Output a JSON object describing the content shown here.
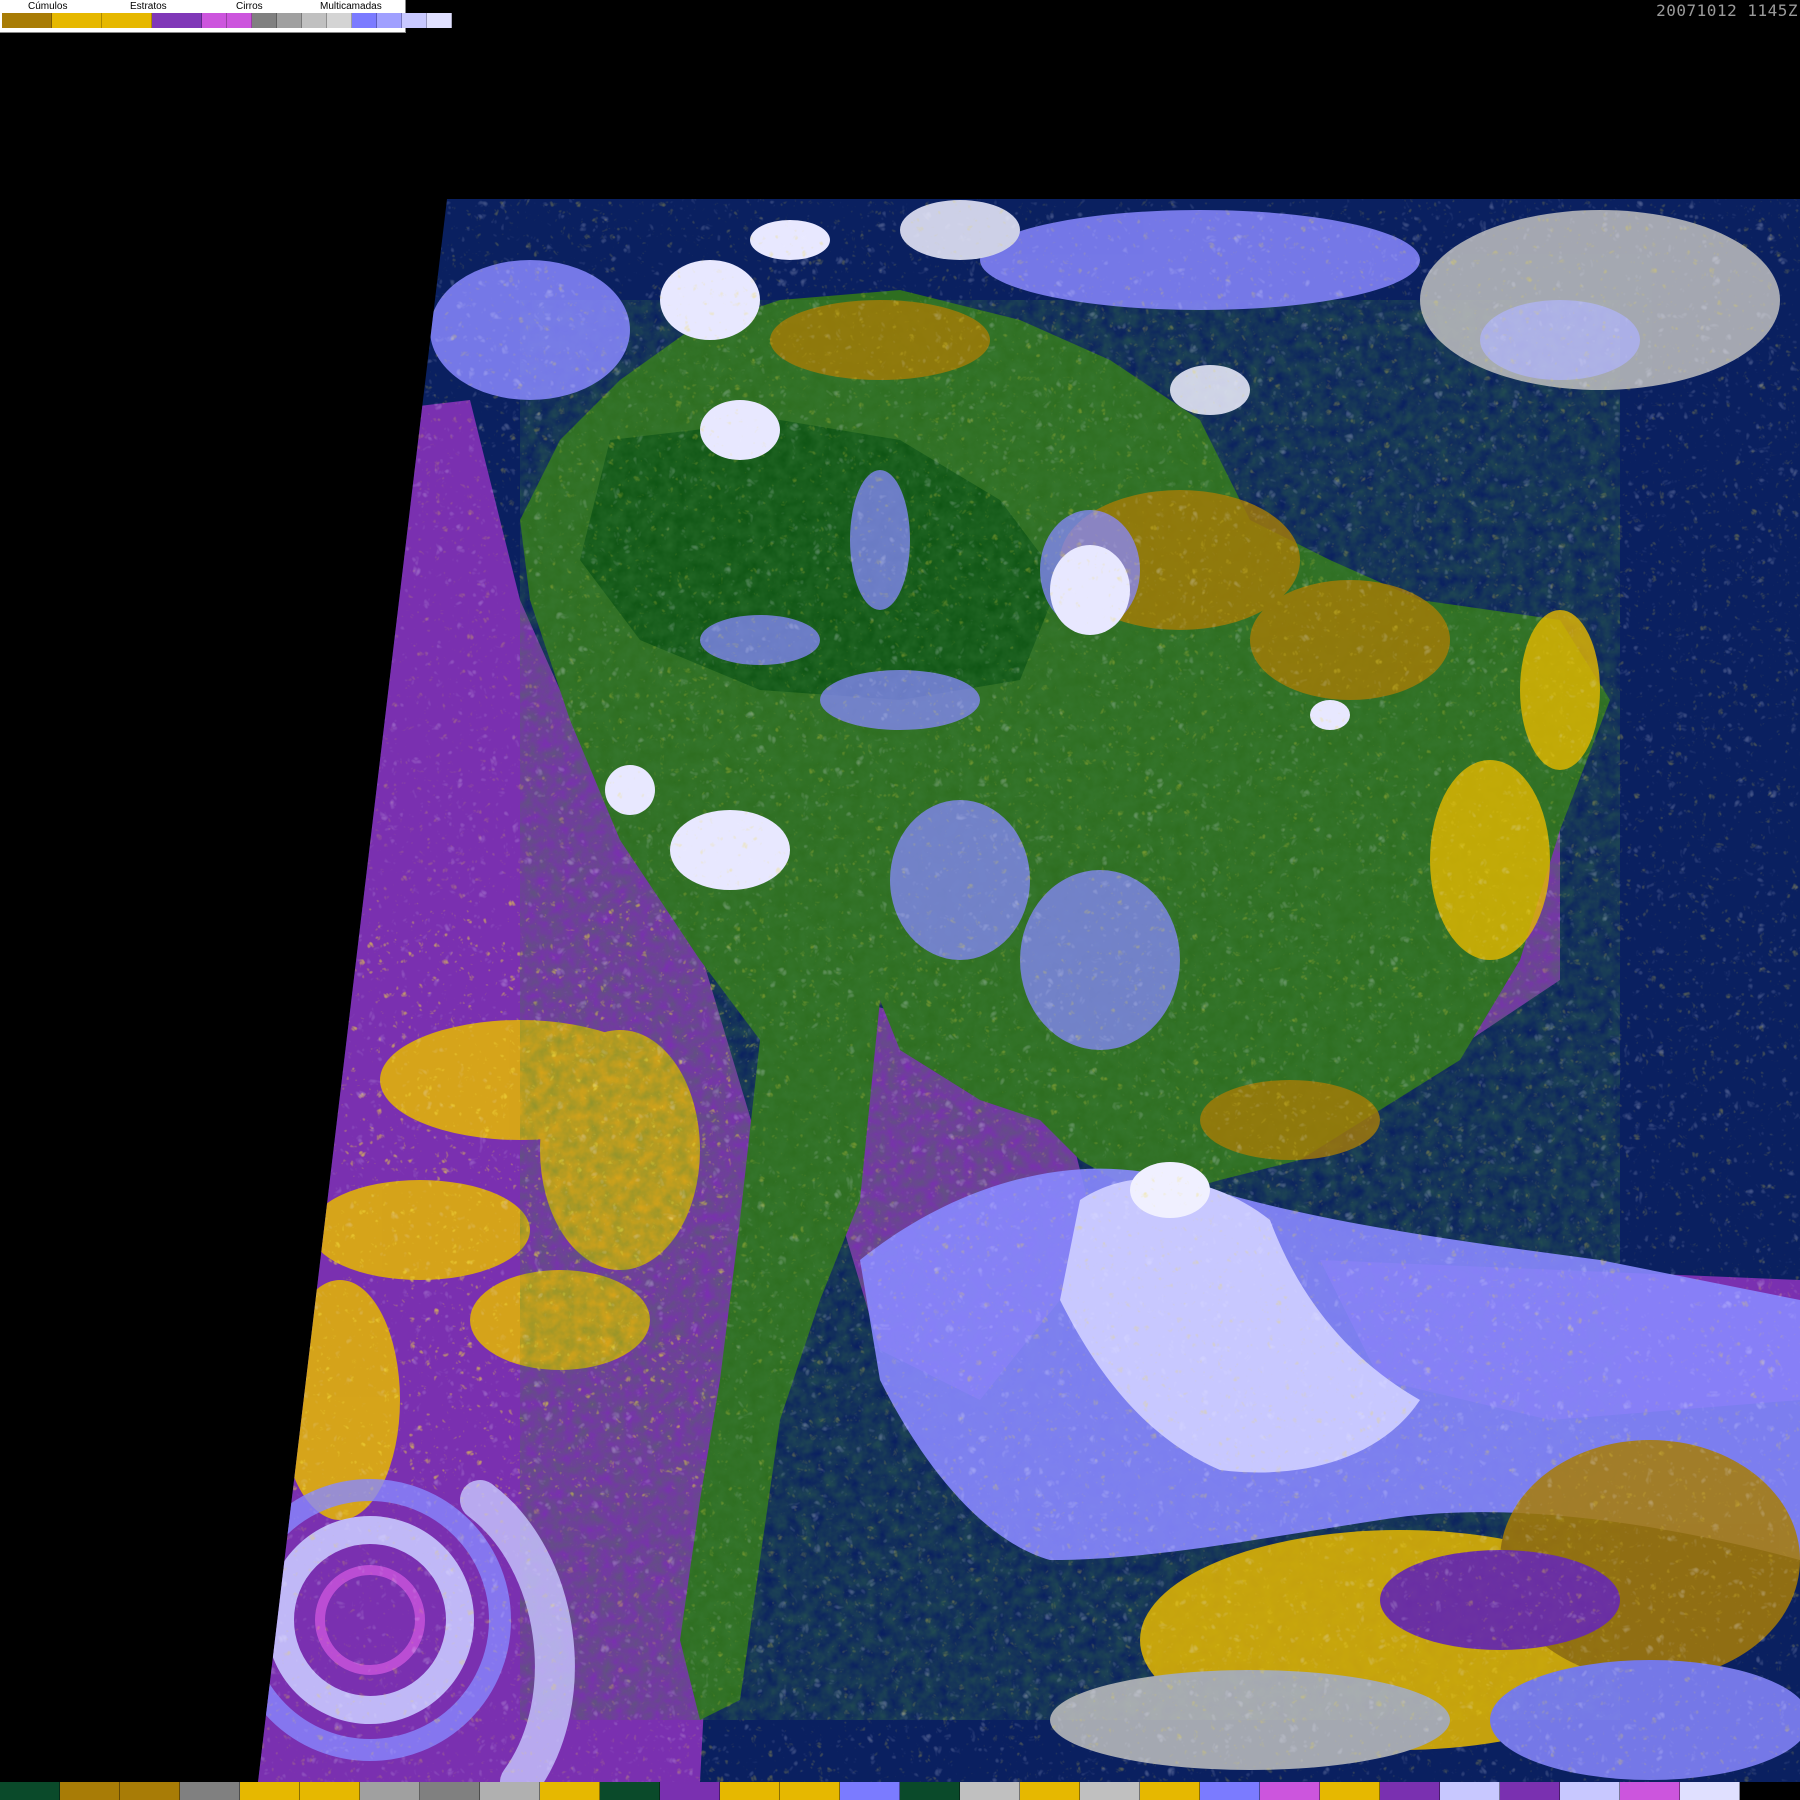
{
  "legend": {
    "categories": [
      {
        "label": "Cúmulos"
      },
      {
        "label": "Estratos"
      },
      {
        "label": "Cirros"
      },
      {
        "label": "Multicamadas"
      }
    ],
    "swatches": [
      "#a87c06",
      "#e6b800",
      "#e6b800",
      "#8038b8",
      "#cc55dd",
      "#cc55dd",
      "#808080",
      "#a0a0a0",
      "#c0c0c0",
      "#d4d4d4",
      "#7b7bff",
      "#a0a0ff",
      "#c8c8ff",
      "#e0e0ff",
      "#ffffff"
    ]
  },
  "timestamp": "20071012  1145Z",
  "colors": {
    "background": "#000000",
    "ocean": "#0a2060",
    "stratus": "#7a30b0",
    "cumulus_dark": "#a87c06",
    "cumulus_light": "#e6b800",
    "land": "#2e6e20",
    "land_dark": "#0f5514",
    "multilayer_light": "#c8c8ff",
    "multilayer_mid": "#8888ff",
    "cirrus": "#b0b0b0",
    "white": "#f0f0ff"
  },
  "bottom_strip": [
    "#0a4a2a",
    "#a87c06",
    "#a87c06",
    "#808080",
    "#e6b800",
    "#e6b800",
    "#a0a0a0",
    "#808080",
    "#b0b0b0",
    "#e6b800",
    "#0a4a2a",
    "#7a30b0",
    "#e6b800",
    "#e6b800",
    "#7b7bff",
    "#0a4a2a",
    "#c0c0c0",
    "#e6b800",
    "#c0c0c0",
    "#e6b800",
    "#7b7bff",
    "#cc55dd",
    "#e6b800",
    "#7a30b0",
    "#c8c8ff",
    "#7a30b0",
    "#c8c8ff",
    "#cc55dd",
    "#e0e0ff",
    "#000000"
  ]
}
